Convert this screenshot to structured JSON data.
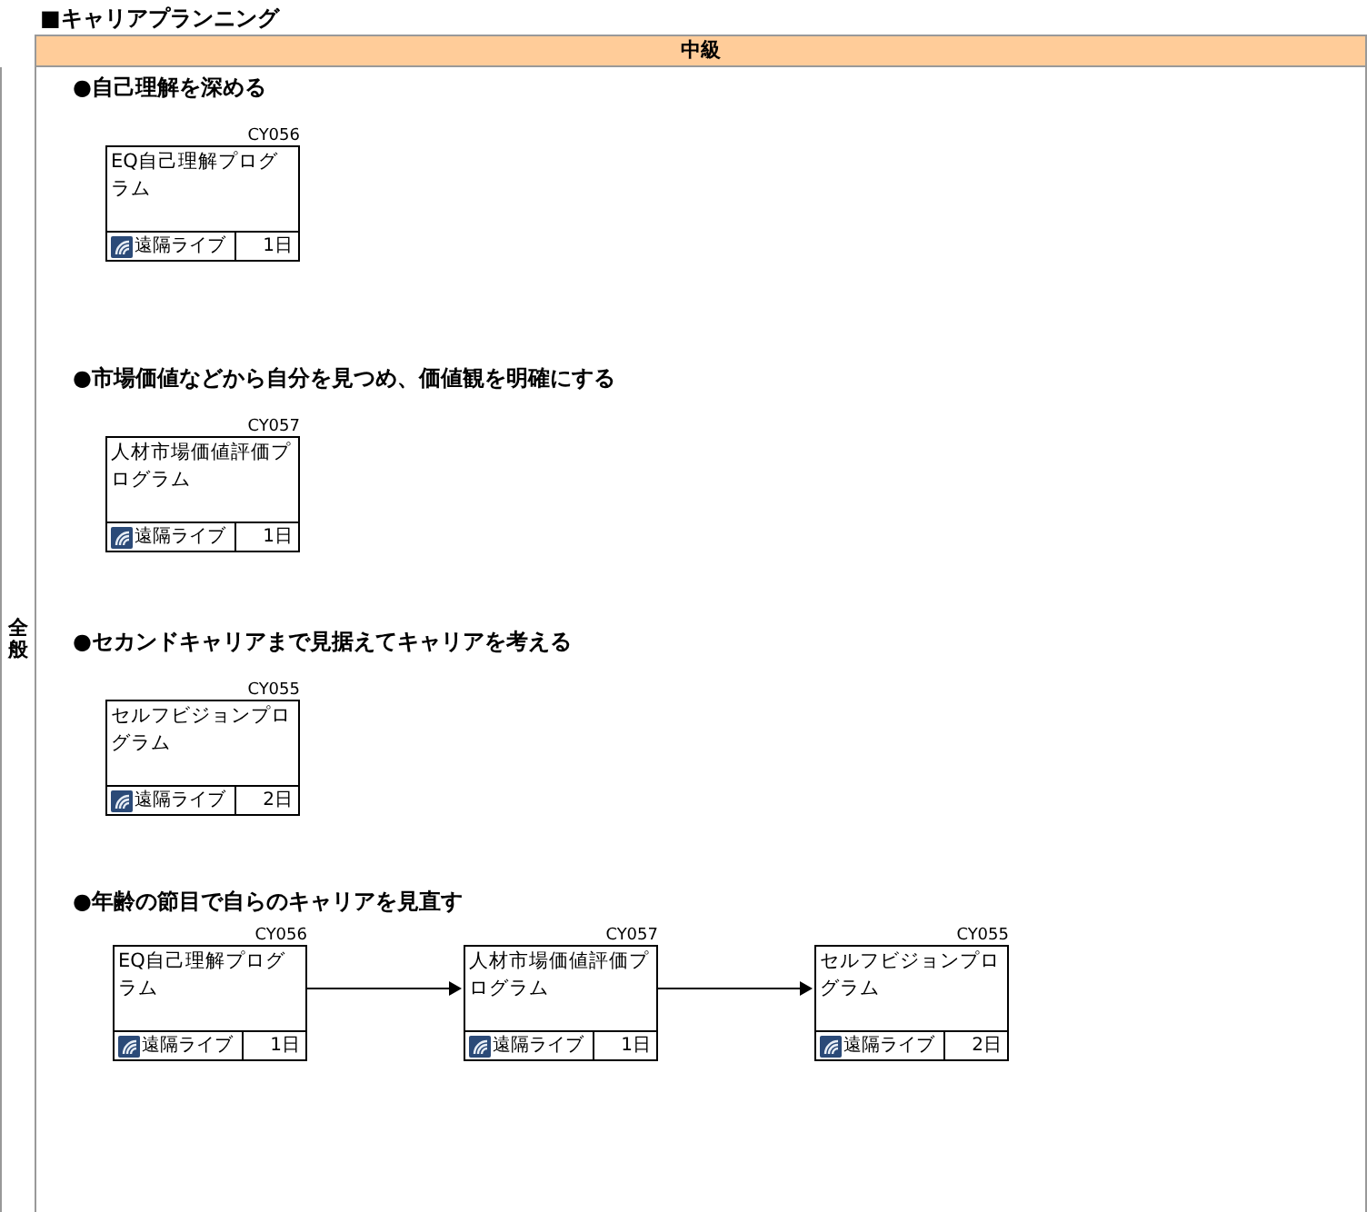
{
  "title": "■キャリアプランニング",
  "level_header": "中級",
  "category": "全般",
  "sections": [
    {
      "heading": "●自己理解を深める",
      "courses": [
        {
          "code": "CY056",
          "name": "EQ自己理解プログラム",
          "delivery": "遠隔ライブ",
          "duration": "1日"
        }
      ]
    },
    {
      "heading": "●市場価値などから自分を見つめ、価値観を明確にする",
      "courses": [
        {
          "code": "CY057",
          "name": "人材市場価値評価プログラム",
          "delivery": "遠隔ライブ",
          "duration": "1日"
        }
      ]
    },
    {
      "heading": "●セカンドキャリアまで見据えてキャリアを考える",
      "courses": [
        {
          "code": "CY055",
          "name": "セルフビジョンプログラム",
          "delivery": "遠隔ライブ",
          "duration": "2日"
        }
      ]
    },
    {
      "heading": "●年齢の節目で自らのキャリアを見直す",
      "courses": [
        {
          "code": "CY056",
          "name": "EQ自己理解プログラム",
          "delivery": "遠隔ライブ",
          "duration": "1日"
        },
        {
          "code": "CY057",
          "name": "人材市場価値評価プログラム",
          "delivery": "遠隔ライブ",
          "duration": "1日"
        },
        {
          "code": "CY055",
          "name": "セルフビジョンプログラム",
          "delivery": "遠隔ライブ",
          "duration": "2日"
        }
      ]
    }
  ]
}
